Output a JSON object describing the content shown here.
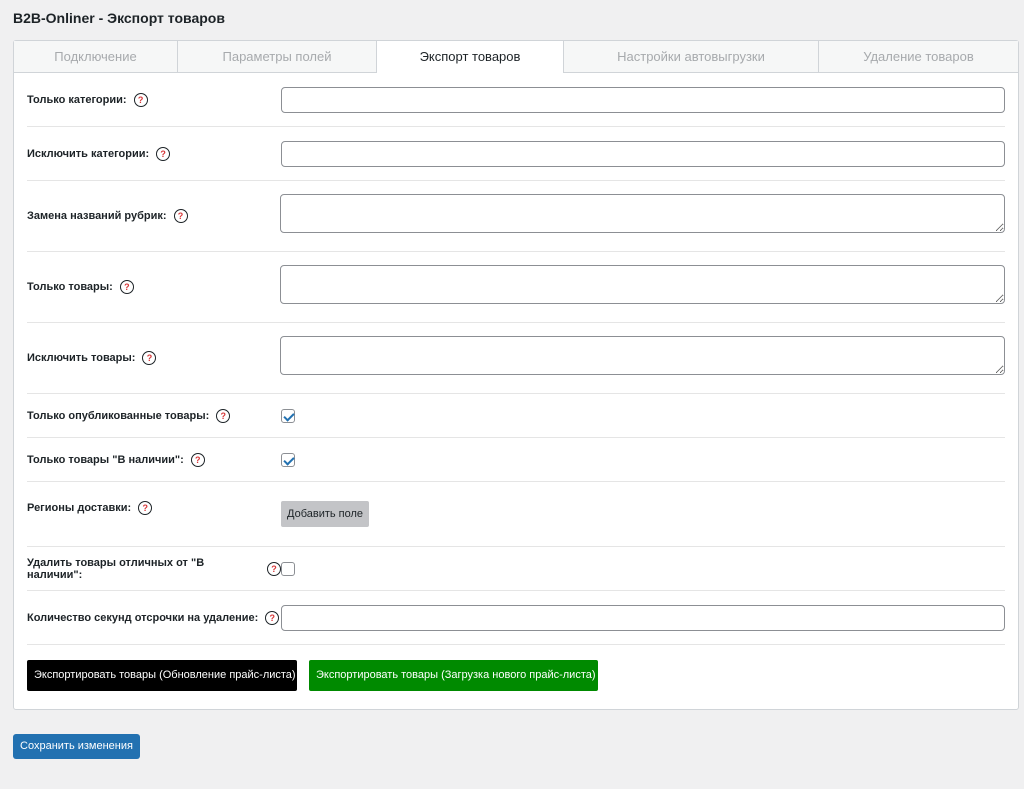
{
  "page": {
    "title": "B2B-Onliner - Экспорт товаров"
  },
  "tabs": [
    {
      "label": "Подключение",
      "active": false
    },
    {
      "label": "Параметры полей",
      "active": false
    },
    {
      "label": "Экспорт товаров",
      "active": true
    },
    {
      "label": "Настройки автовыгрузки",
      "active": false
    },
    {
      "label": "Удаление товаров",
      "active": false
    }
  ],
  "help_glyph": "?",
  "fields": {
    "only_categories": {
      "label": "Только категории:",
      "value": ""
    },
    "exclude_categories": {
      "label": "Исключить категории:",
      "value": ""
    },
    "rename_rubrics": {
      "label": "Замена названий рубрик:",
      "value": ""
    },
    "only_products": {
      "label": "Только товары:",
      "value": ""
    },
    "exclude_products": {
      "label": "Исключить товары:",
      "value": ""
    },
    "only_published": {
      "label": "Только опубликованные товары:",
      "checked": true
    },
    "only_in_stock": {
      "label": "Только товары \"В наличии\":",
      "checked": true
    },
    "delivery_regions": {
      "label": "Регионы доставки:",
      "button": "Добавить поле"
    },
    "delete_not_in_stock": {
      "label": "Удалить товары отличных от \"В наличии\":",
      "checked": false
    },
    "delete_delay_seconds": {
      "label": "Количество секунд отсрочки на удаление:",
      "value": ""
    }
  },
  "actions": {
    "export_update": "Экспортировать товары (Обновление прайс-листа)",
    "export_new": "Экспортировать товары (Загрузка нового прайс-листа)"
  },
  "save_button": "Сохранить изменения",
  "colors": {
    "primary": "#2271b1",
    "export_update_bg": "#000000",
    "export_new_bg": "#008a00",
    "help_mark": "#d63638"
  }
}
